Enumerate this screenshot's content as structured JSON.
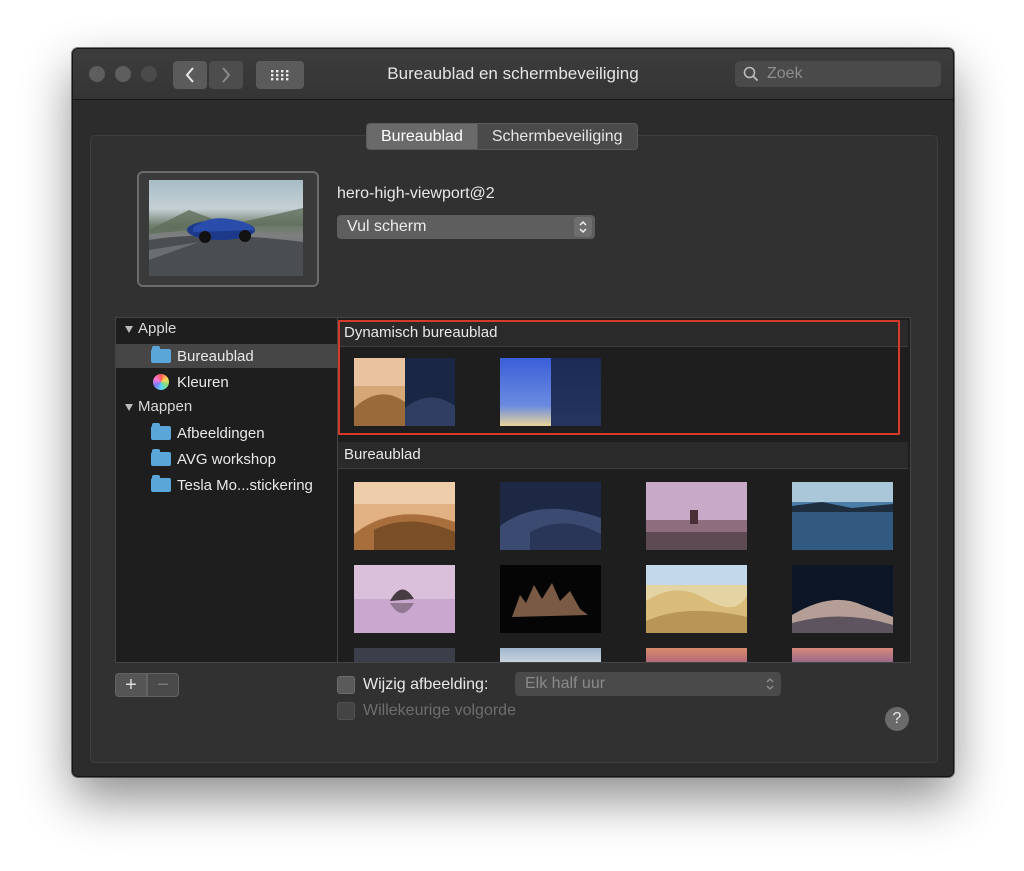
{
  "window": {
    "title": "Bureaublad en schermbeveiliging"
  },
  "search": {
    "placeholder": "Zoek"
  },
  "tabs": [
    {
      "label": "Bureaublad",
      "active": true
    },
    {
      "label": "Schermbeveiliging",
      "active": false
    }
  ],
  "current": {
    "name": "hero-high-viewport@2",
    "fill_mode": "Vul scherm"
  },
  "sidebar": {
    "groups": [
      {
        "label": "Apple",
        "items": [
          {
            "label": "Bureaublad",
            "icon": "folder-icon",
            "selected": true
          },
          {
            "label": "Kleuren",
            "icon": "color-wheel-icon"
          }
        ]
      },
      {
        "label": "Mappen",
        "items": [
          {
            "label": "Afbeeldingen",
            "icon": "pictures-folder-icon"
          },
          {
            "label": "AVG workshop",
            "icon": "folder-icon"
          },
          {
            "label": "Tesla Mo...stickering",
            "icon": "folder-icon"
          }
        ]
      }
    ]
  },
  "sections": {
    "dynamic": "Dynamisch bureaublad",
    "desktop": "Bureaublad"
  },
  "controls": {
    "change_picture": "Wijzig afbeelding:",
    "interval": "Elk half uur",
    "random_order": "Willekeurige volgorde",
    "help": "?",
    "add": "+",
    "remove": "−"
  },
  "colors": {
    "highlight": "#d63a2a",
    "folder": "#5aa6d9",
    "window_bg": "#2c2c2c"
  }
}
